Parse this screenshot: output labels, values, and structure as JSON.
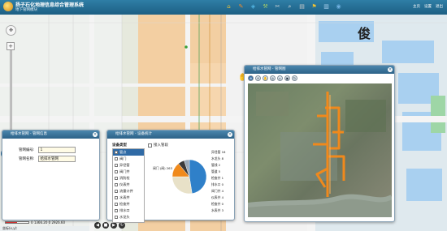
{
  "app": {
    "title": "扬子石化地理信息综合管理系统",
    "subtitle": "地下管网模块",
    "header_links": [
      "主页",
      "设置",
      "退出"
    ]
  },
  "toolbar": {
    "icons": [
      {
        "name": "home-icon",
        "glyph": "⌂",
        "color": "#e8c13a"
      },
      {
        "name": "pen-icon",
        "glyph": "✎",
        "color": "#f08a2e"
      },
      {
        "name": "layers-icon",
        "glyph": "◈",
        "color": "#54b8e6"
      },
      {
        "name": "tool-icon",
        "glyph": "⚒",
        "color": "#9fc86a"
      },
      {
        "name": "measure-icon",
        "glyph": "✂",
        "color": "#d9d9d9"
      },
      {
        "name": "search-icon",
        "glyph": "⌕",
        "color": "#e0e0e0"
      },
      {
        "name": "print-icon",
        "glyph": "▤",
        "color": "#c9c9c9"
      },
      {
        "name": "flag-icon",
        "glyph": "⚑",
        "color": "#f1c232"
      },
      {
        "name": "chart-icon",
        "glyph": "▥",
        "color": "#a8d0ee"
      },
      {
        "name": "globe-icon",
        "glyph": "◉",
        "color": "#6fb0e0"
      }
    ]
  },
  "map": {
    "label_char": "俊",
    "scale_text": "0    1366.20 0    2926.60",
    "status_text": "坐标(x,y):"
  },
  "pipe_panel": {
    "title": "给排水管网 - 管网信息",
    "rows": [
      {
        "label": "管网编号:",
        "value": "1"
      },
      {
        "label": "管网名称:",
        "value": "给排水管网"
      }
    ]
  },
  "device_panel": {
    "title": "给排水管网 - 设备统计",
    "header": "设备类型",
    "show_label": "接入管段",
    "items": [
      "管点",
      "阀门",
      "异径管",
      "阀门井",
      "消防栓",
      "仪表井",
      "流量计井",
      "水表井",
      "检查井",
      "排水口",
      "水龙头"
    ]
  },
  "chart_data": {
    "type": "pie",
    "title": "",
    "slices": [
      {
        "label": "阀门 (阀) 2",
        "value": 47.5,
        "color": "#2f80c9"
      },
      {
        "label": "异径管 16",
        "value": 27.5,
        "color": "#e8e1c8"
      },
      {
        "label": "水龙头 8",
        "value": 14.0,
        "color": "#f08a1c"
      },
      {
        "label": "消防栓 3",
        "value": 6.0,
        "color": "#3a3a3a"
      },
      {
        "label": "检查井 1",
        "value": 5.0,
        "color": "#9aa9b8"
      }
    ],
    "labels_right": [
      "异径管 16",
      "水龙头 8",
      "管线 2",
      "管道 5",
      "检查井 1",
      "排水口 0",
      "阀门井 4",
      "仪表井 4",
      "检查井 0",
      "水表井 3"
    ],
    "label_left": "阀门 (阀) 263"
  },
  "image_panel": {
    "title": "给排水管网 - 管网图",
    "tools": [
      "⊕",
      "⊖",
      "✋",
      "◎",
      "⌂",
      "▣",
      "↻"
    ]
  }
}
